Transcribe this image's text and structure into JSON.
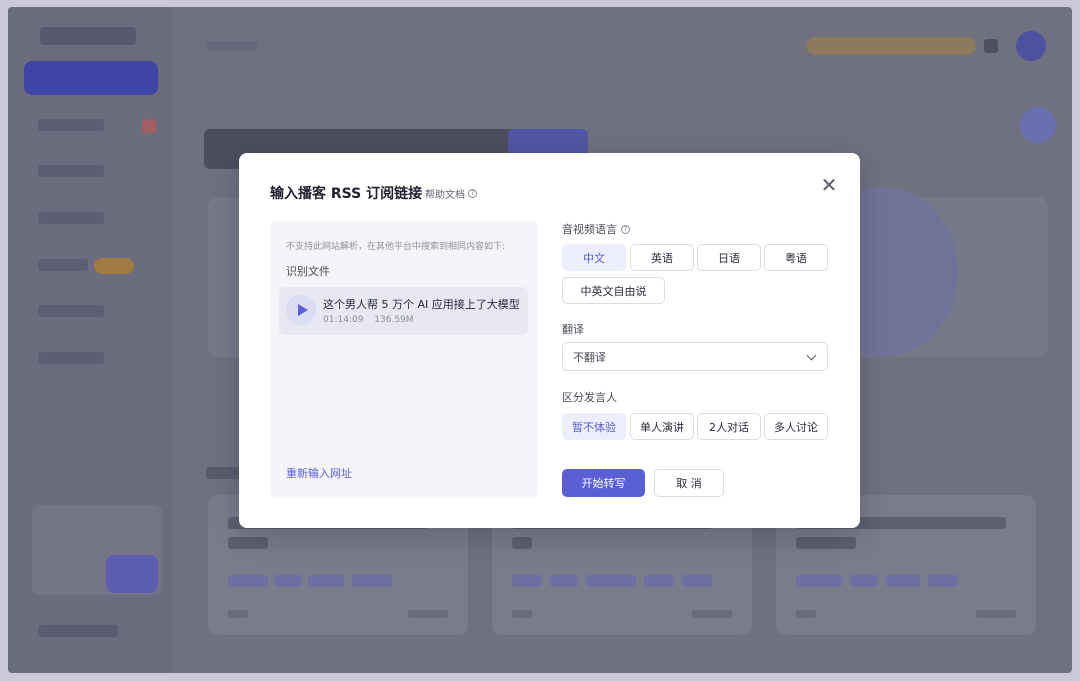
{
  "modal": {
    "title": "输入播客 RSS 订阅链接",
    "help_link": "帮助文档",
    "help_icon": "question-circle-icon",
    "close_icon": "close-icon",
    "close_glyph": "✕"
  },
  "left_panel": {
    "note": "不支持此网站解析，在其他平台中搜索到相同内容如下:",
    "section_label": "识别文件",
    "file": {
      "name": "这个男人帮 5 万个 AI 应用接上了大模型",
      "duration": "01:14:09",
      "size": "136.59M"
    },
    "reenter_link": "重新输入网址"
  },
  "language": {
    "label": "音视频语言",
    "options": [
      "中文",
      "英语",
      "日语",
      "粤语",
      "中英文自由说"
    ],
    "selected": "中文"
  },
  "translation": {
    "label": "翻译",
    "value": "不翻译"
  },
  "speaker": {
    "label": "区分发言人",
    "options": [
      "暂不体验",
      "单人演讲",
      "2人对话",
      "多人讨论"
    ],
    "selected": "暂不体验"
  },
  "actions": {
    "start": "开始转写",
    "cancel": "取 消"
  },
  "colors": {
    "accent": "#5a5fd6",
    "overlay": "#6f7080"
  }
}
